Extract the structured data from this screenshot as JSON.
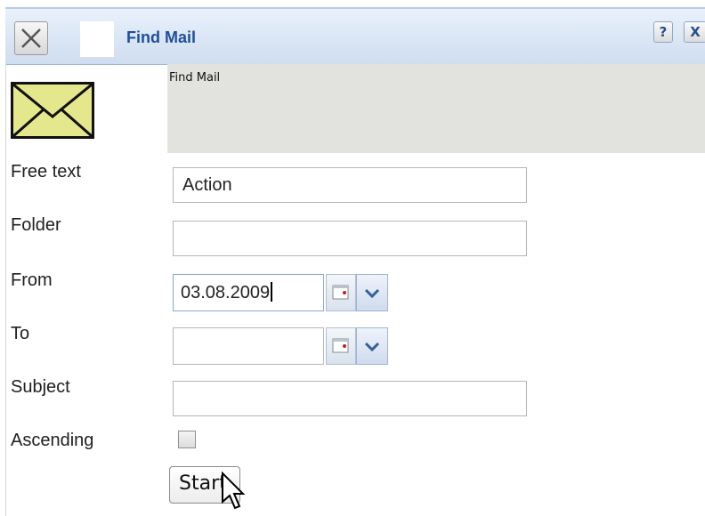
{
  "window": {
    "title": "Find Mail",
    "help_glyph": "?",
    "close_glyph": "X"
  },
  "panel": {
    "caption": "Find Mail"
  },
  "icons": {
    "envelope": "envelope-icon",
    "calendar": "calendar-icon",
    "chevron": "chevron-down-icon"
  },
  "form": {
    "free_text": {
      "label": "Free text",
      "value": "Action"
    },
    "folder": {
      "label": "Folder",
      "value": ""
    },
    "from": {
      "label": "From",
      "value": "03.08.2009"
    },
    "to": {
      "label": "To",
      "value": ""
    },
    "subject": {
      "label": "Subject",
      "value": ""
    },
    "ascending": {
      "label": "Ascending",
      "checked": false
    },
    "start_label": "Start"
  },
  "colors": {
    "title": "#1e4f9a",
    "envelope_fill": "#e5e78d",
    "panel_bg": "#e2e2de"
  }
}
